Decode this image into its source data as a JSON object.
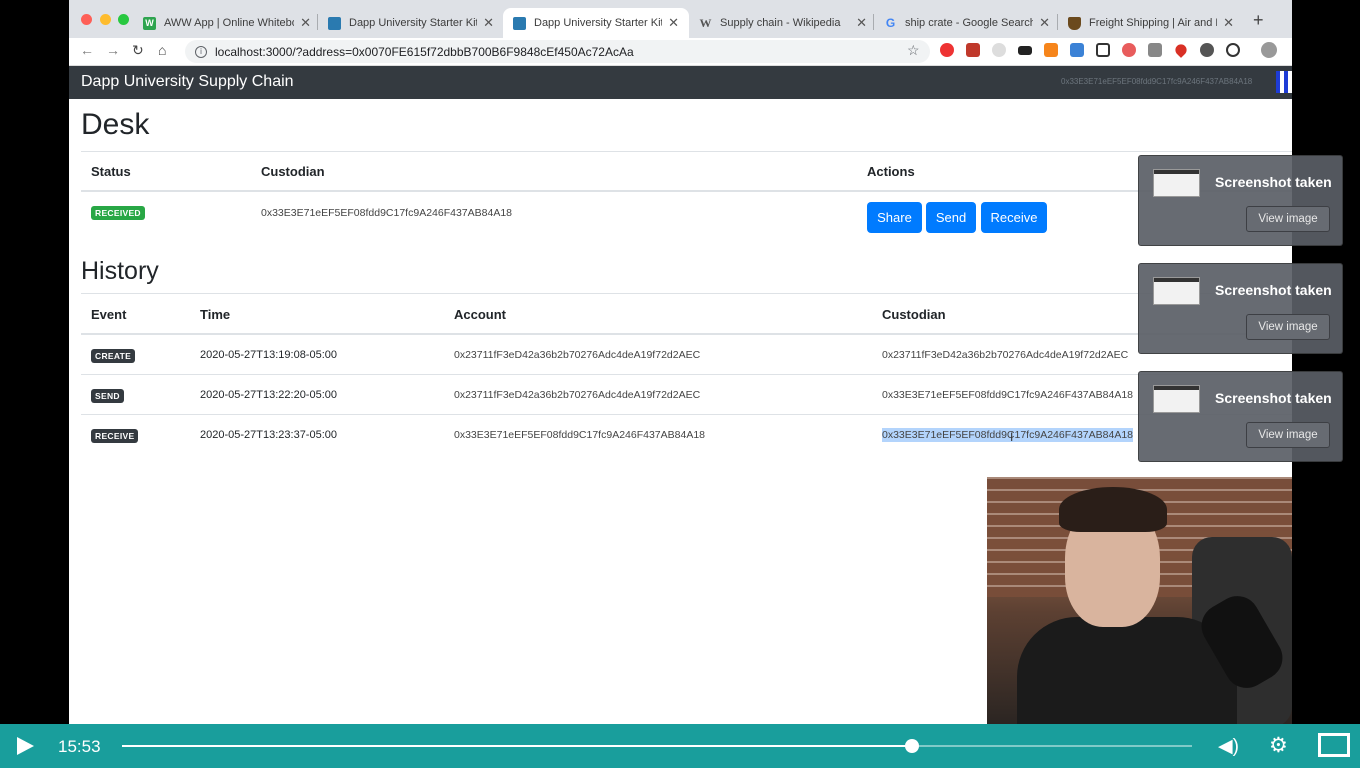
{
  "browser": {
    "tabs": [
      {
        "title": "AWW App | Online Whiteboard",
        "favicon": "W",
        "favicon_color": "#2ea44f",
        "active": false
      },
      {
        "title": "Dapp University Starter Kit",
        "favicon": "",
        "favicon_color": "#2a7ab0",
        "active": false
      },
      {
        "title": "Dapp University Starter Kit",
        "favicon": "",
        "favicon_color": "#2a7ab0",
        "active": true
      },
      {
        "title": "Supply chain - Wikipedia",
        "favicon": "W",
        "favicon_color": "#555555",
        "active": false
      },
      {
        "title": "ship crate - Google Search",
        "favicon": "G",
        "favicon_color": "#4285f4",
        "active": false
      },
      {
        "title": "Freight Shipping | Air and Mo",
        "favicon": "",
        "favicon_color": "#6b4a1e",
        "active": false
      }
    ],
    "url": "localhost:3000/?address=0x0070FE615f72dbbB700B6F9848cEf450Ac72AcAa"
  },
  "page": {
    "brand": "Dapp University Supply Chain",
    "nav_account": "0x33E3E71eEF5EF08fdd9C17fc9A246F437AB84A18",
    "desk": {
      "heading": "Desk",
      "columns": [
        "Status",
        "Custodian",
        "Actions"
      ],
      "status_badge": "RECEIVED",
      "custodian": "0x33E3E71eEF5EF08fdd9C17fc9A246F437AB84A18",
      "actions": [
        "Share",
        "Send",
        "Receive"
      ]
    },
    "history": {
      "heading": "History",
      "columns": [
        "Event",
        "Time",
        "Account",
        "Custodian"
      ],
      "rows": [
        {
          "event": "CREATE",
          "time": "2020-05-27T13:19:08-05:00",
          "account": "0x23711fF3eD42a36b2b70276Adc4deA19f72d2AEC",
          "custodian": "0x23711fF3eD42a36b2b70276Adc4deA19f72d2AEC"
        },
        {
          "event": "SEND",
          "time": "2020-05-27T13:22:20-05:00",
          "account": "0x23711fF3eD42a36b2b70276Adc4deA19f72d2AEC",
          "custodian": "0x33E3E71eEF5EF08fdd9C17fc9A246F437AB84A18"
        },
        {
          "event": "RECEIVE",
          "time": "2020-05-27T13:23:37-05:00",
          "account": "0x33E3E71eEF5EF08fdd9C17fc9A246F437AB84A18",
          "custodian": "0x33E3E71eEF5EF08fdd9C17fc9A246F437AB84A18"
        }
      ]
    }
  },
  "toasts": [
    {
      "title": "Screenshot taken",
      "button": "View image"
    },
    {
      "title": "Screenshot taken",
      "button": "View image"
    },
    {
      "title": "Screenshot taken",
      "button": "View image"
    }
  ],
  "player": {
    "time": "15:53",
    "progress": 0.738
  },
  "colors": {
    "navbar": "#343a40",
    "primary_button": "#007bff",
    "badge_received": "#28a745",
    "badge_dark": "#343a40",
    "player_bar": "#1aa7a4"
  }
}
